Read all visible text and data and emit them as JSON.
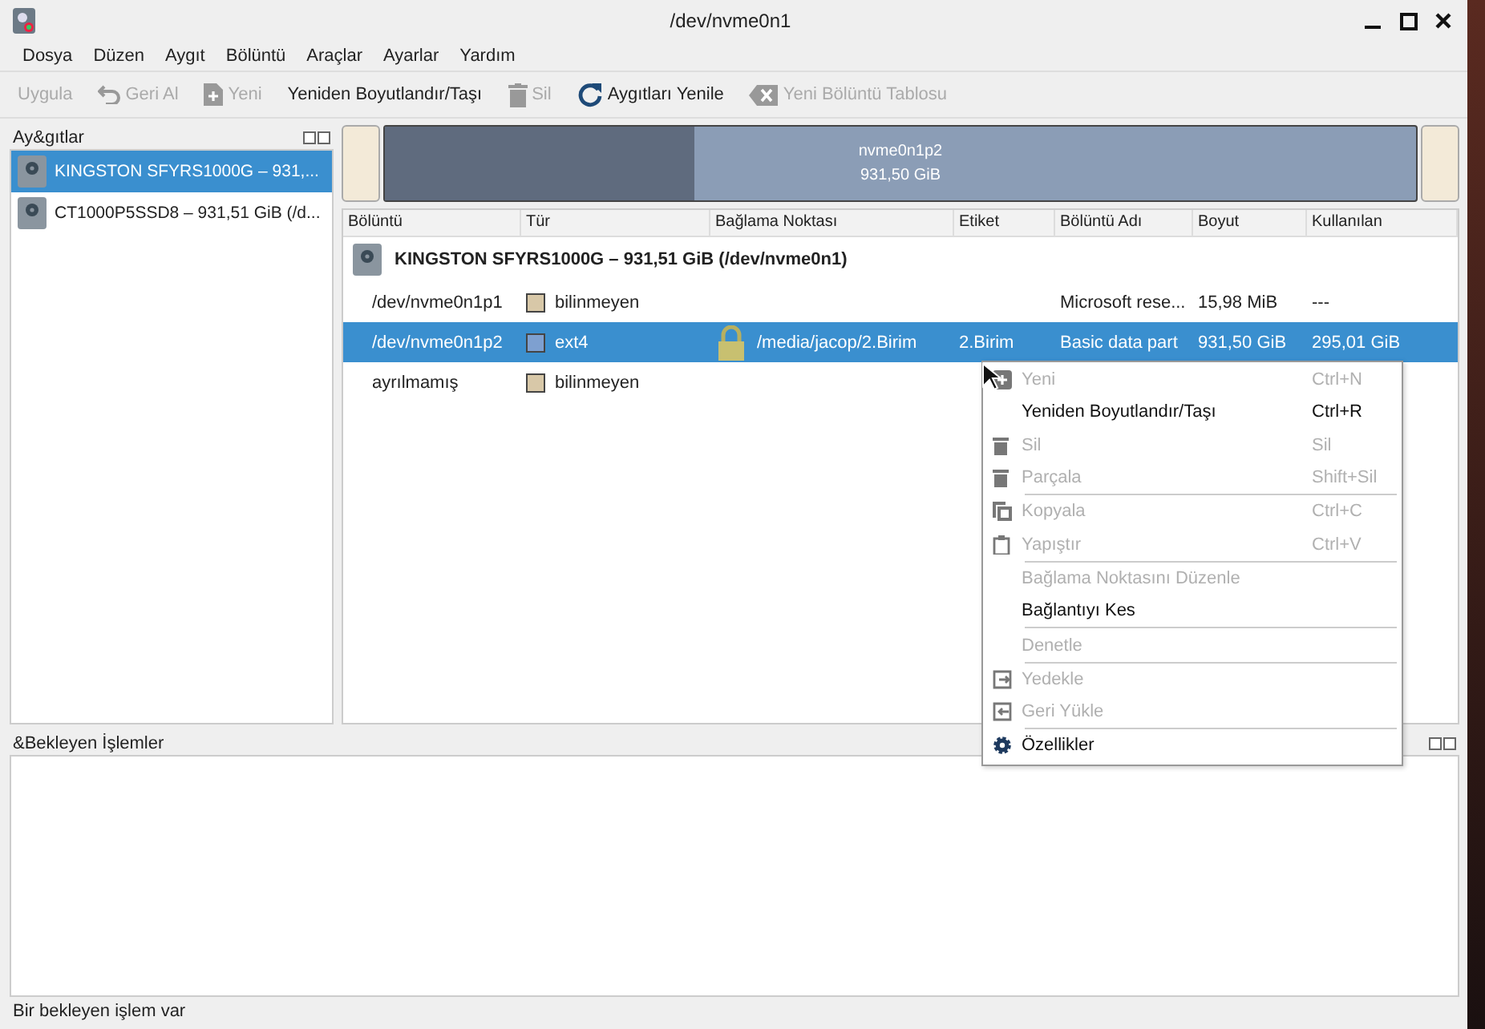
{
  "window": {
    "title": "/dev/nvme0n1"
  },
  "menu": [
    "Dosya",
    "Düzen",
    "Aygıt",
    "Bölüntü",
    "Araçlar",
    "Ayarlar",
    "Yardım"
  ],
  "toolbar": [
    {
      "kind": "text",
      "label": "Uygula",
      "disabled": true
    },
    {
      "kind": "undo",
      "label": "Geri Al",
      "disabled": true
    },
    {
      "kind": "new",
      "label": "Yeni",
      "disabled": true
    },
    {
      "kind": "text",
      "label": "Yeniden Boyutlandır/Taşı",
      "disabled": false
    },
    {
      "kind": "delete",
      "label": "Sil",
      "disabled": true
    },
    {
      "kind": "refresh",
      "label": "Aygıtları Yenile",
      "disabled": false
    },
    {
      "kind": "table",
      "label": "Yeni Bölüntü Tablosu",
      "disabled": true
    }
  ],
  "devices_panel": {
    "title": "Ay&gıtlar",
    "items": [
      {
        "label": "KINGSTON SFYRS1000G – 931,...",
        "selected": true
      },
      {
        "label": "CT1000P5SSD8 – 931,51 GiB (/d...",
        "selected": false
      }
    ]
  },
  "partition_bar": {
    "segments": [
      {
        "kind": "unknown",
        "selected": false
      },
      {
        "kind": "used",
        "name": "nvme0n1p2",
        "size": "931,50 GiB",
        "level": 0.3,
        "selected": true
      },
      {
        "kind": "unknown",
        "selected": false
      }
    ]
  },
  "table": {
    "columns": [
      "Bölüntü",
      "Tür",
      "Bağlama Noktası",
      "Etiket",
      "Bölüntü Adı",
      "Boyut",
      "Kullanılan"
    ],
    "device": "KINGSTON SFYRS1000G – 931,51 GiB (/dev/nvme0n1)",
    "rows": [
      {
        "partition": "/dev/nvme0n1p1",
        "type": "bilinmeyen",
        "color": "#d8c8a8",
        "locked": false,
        "name": "Microsoft rese...",
        "size": "15,98 MiB",
        "used": "---",
        "selected": false
      },
      {
        "partition": "/dev/nvme0n1p2",
        "type": "ext4",
        "color": "#7ea0d0",
        "locked": true,
        "mount": "/media/jacop/2.Birim",
        "label": "2.Birim",
        "name": "Basic data part",
        "size": "931,50 GiB",
        "used": "295,01 GiB",
        "selected": true
      },
      {
        "partition": "ayrılmamış",
        "type": "bilinmeyen",
        "color": "#d8c8a8",
        "locked": false,
        "selected": false
      }
    ]
  },
  "context_menu": [
    {
      "kind": "item",
      "label": "Yeni",
      "shortcut": "Ctrl+N",
      "disabled": true
    },
    {
      "kind": "item",
      "label": "Yeniden Boyutlandır/Taşı",
      "shortcut": "Ctrl+R",
      "disabled": false
    },
    {
      "kind": "item",
      "label": "Sil",
      "shortcut": "Sil",
      "disabled": true
    },
    {
      "kind": "item",
      "label": "Parçala",
      "shortcut": "Shift+Sil",
      "disabled": true
    },
    {
      "kind": "separator"
    },
    {
      "kind": "item",
      "label": "Kopyala",
      "shortcut": "Ctrl+C",
      "disabled": true
    },
    {
      "kind": "item",
      "label": "Yapıştır",
      "shortcut": "Ctrl+V",
      "disabled": true
    },
    {
      "kind": "separator"
    },
    {
      "kind": "item",
      "label": "Bağlama Noktasını Düzenle",
      "disabled": true
    },
    {
      "kind": "item",
      "label": "Bağlantıyı Kes",
      "disabled": false
    },
    {
      "kind": "separator"
    },
    {
      "kind": "item",
      "label": "Denetle",
      "disabled": true
    },
    {
      "kind": "separator"
    },
    {
      "kind": "item",
      "label": "Yedekle",
      "disabled": true
    },
    {
      "kind": "item",
      "label": "Geri Yükle",
      "disabled": true
    },
    {
      "kind": "separator"
    },
    {
      "kind": "item",
      "label": "Özellikler",
      "disabled": false
    }
  ],
  "pending_panel": {
    "title": "&Bekleyen İşlemler"
  },
  "status_bar": "Bir bekleyen işlem var"
}
